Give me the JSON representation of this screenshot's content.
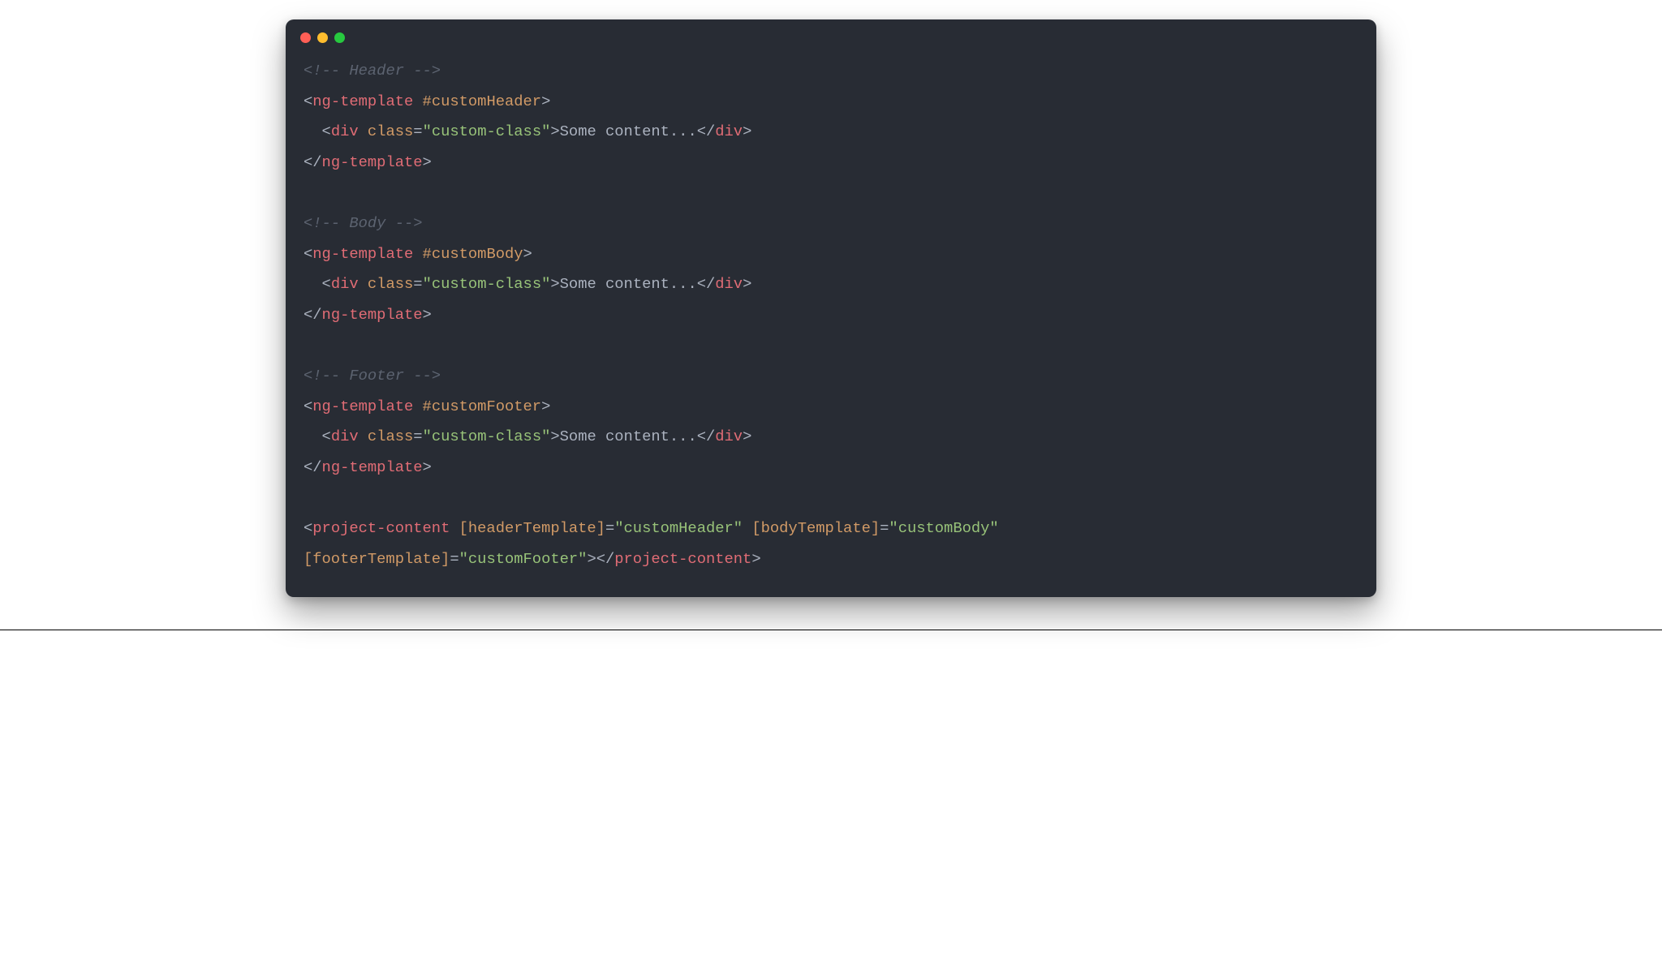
{
  "code": {
    "comment_open": "<!-- ",
    "comment_close": " -->",
    "header_comment": "Header",
    "body_comment": "Body",
    "footer_comment": "Footer",
    "punct_open": "<",
    "punct_open_end": "</",
    "punct_close": ">",
    "punct_selfclose": ">",
    "eq": "=",
    "quote": "\"",
    "space": " ",
    "indent": "  ",
    "tag_ng_template": "ng-template",
    "tag_div": "div",
    "tag_project_content": "project-content",
    "attr_ref_header": "#customHeader",
    "attr_ref_body": "#customBody",
    "attr_ref_footer": "#customFooter",
    "attr_class": "class",
    "attr_header_tpl": "[headerTemplate]",
    "attr_body_tpl": "[bodyTemplate]",
    "attr_footer_tpl": "[footerTemplate]",
    "val_custom_class": "custom-class",
    "val_custom_header": "customHeader",
    "val_custom_body": "customBody",
    "val_custom_footer": "customFooter",
    "text_some_content": "Some content..."
  }
}
